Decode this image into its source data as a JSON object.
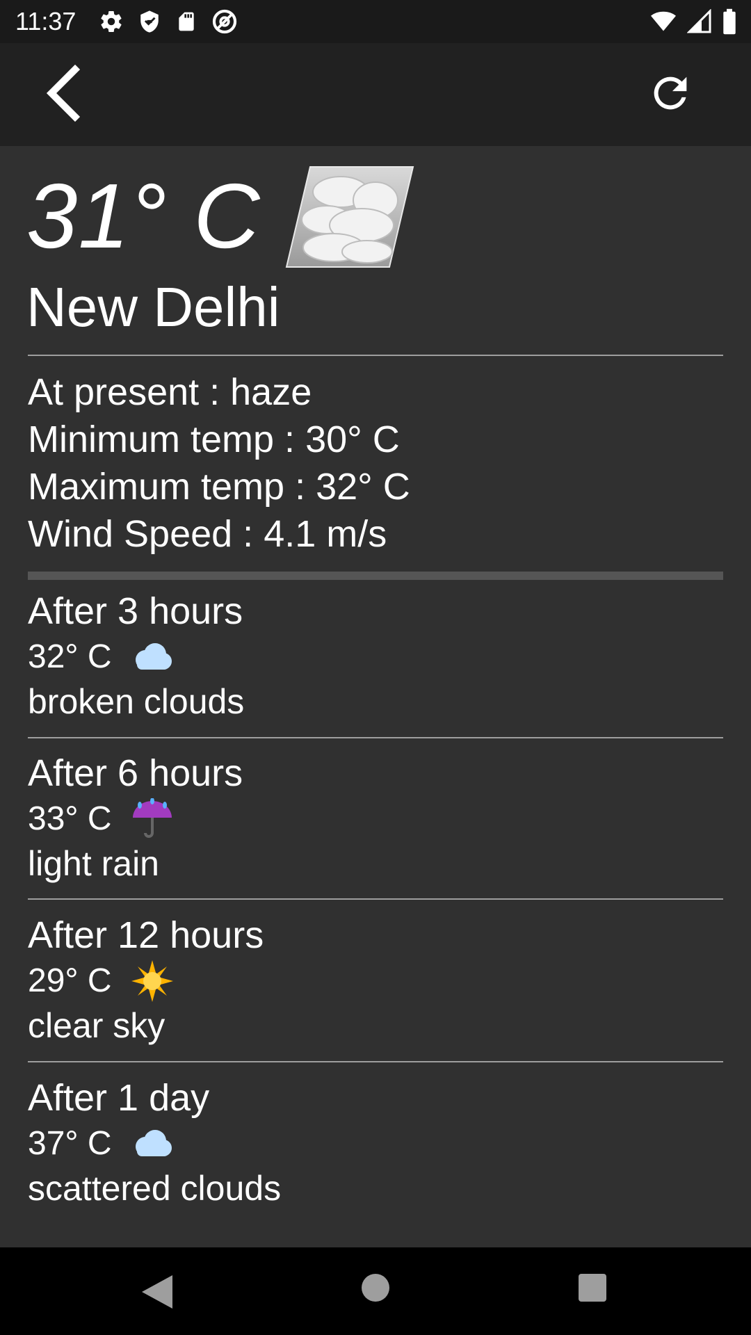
{
  "status_bar": {
    "time": "11:37",
    "left_icons": [
      "gear-icon",
      "shield-icon",
      "sd-card-icon",
      "at-sign-icon"
    ],
    "right_icons": [
      "wifi-icon",
      "cell-signal-icon",
      "battery-icon"
    ]
  },
  "app_bar": {
    "back_icon": "chevron-left-icon",
    "refresh_icon": "refresh-icon"
  },
  "current": {
    "temperature": "31° C",
    "icon": "haze-clouds-icon",
    "city": "New Delhi",
    "details": [
      "At present : haze",
      "Minimum temp : 30° C",
      "Maximum temp : 32° C",
      "Wind Speed : 4.1 m/s"
    ]
  },
  "forecast": [
    {
      "title": "After 3 hours",
      "temp": "32° C",
      "icon": "cloud-icon",
      "desc": "broken clouds"
    },
    {
      "title": "After 6 hours",
      "temp": "33° C",
      "icon": "umbrella-rain-icon",
      "desc": "light rain"
    },
    {
      "title": "After 12 hours",
      "temp": "29° C",
      "icon": "sun-icon",
      "desc": "clear sky"
    },
    {
      "title": "After 1 day",
      "temp": "37° C",
      "icon": "cloud-icon",
      "desc": "scattered clouds"
    }
  ],
  "colors": {
    "background": "#303030",
    "app_bar": "#212121",
    "status_bar": "#1a1a1a",
    "divider": "#9e9e9e",
    "text": "#ffffff"
  }
}
